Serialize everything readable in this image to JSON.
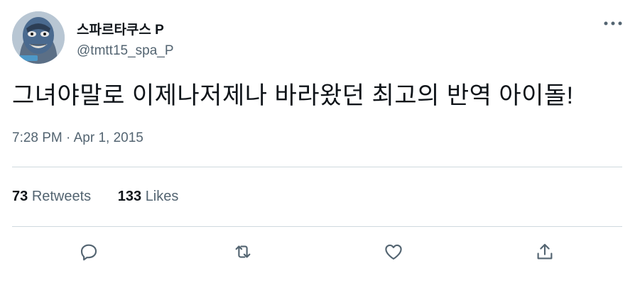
{
  "tweet": {
    "display_name": "스파르타쿠스 P",
    "handle": "@tmtt15_spa_P",
    "text": "그녀야말로 이제나저제나 바라왔던 최고의 반역 아이돌!",
    "timestamp": "7:28 PM · Apr 1, 2015"
  },
  "stats": {
    "retweets_count": "73",
    "retweets_label": "Retweets",
    "likes_count": "133",
    "likes_label": "Likes"
  },
  "icons": {
    "more": "more-horizontal-icon",
    "reply": "reply-icon",
    "retweet": "retweet-icon",
    "like": "like-icon",
    "share": "share-icon"
  },
  "colors": {
    "text": "#0f1419",
    "secondary": "#536471",
    "divider": "#cfd9de"
  }
}
